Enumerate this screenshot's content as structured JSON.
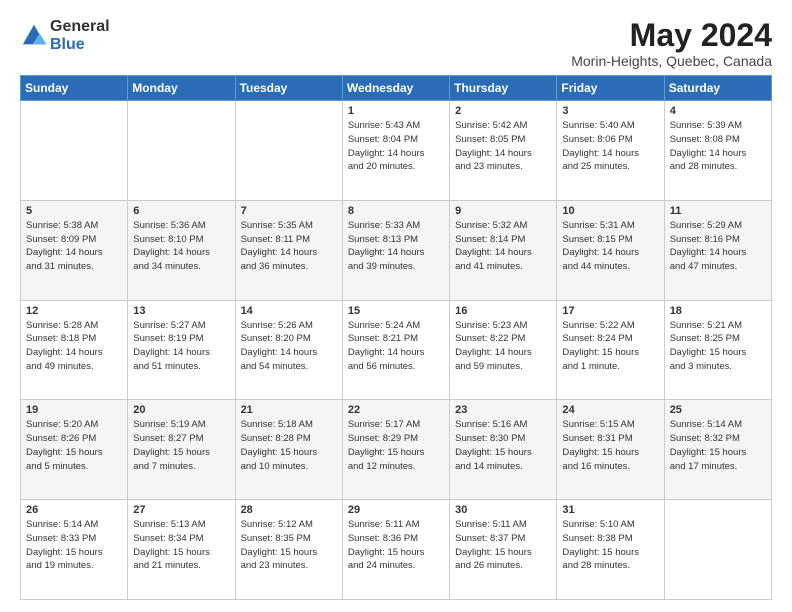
{
  "logo": {
    "general": "General",
    "blue": "Blue"
  },
  "title": "May 2024",
  "location": "Morin-Heights, Quebec, Canada",
  "days_of_week": [
    "Sunday",
    "Monday",
    "Tuesday",
    "Wednesday",
    "Thursday",
    "Friday",
    "Saturday"
  ],
  "weeks": [
    [
      {
        "day": "",
        "info": ""
      },
      {
        "day": "",
        "info": ""
      },
      {
        "day": "",
        "info": ""
      },
      {
        "day": "1",
        "info": "Sunrise: 5:43 AM\nSunset: 8:04 PM\nDaylight: 14 hours\nand 20 minutes."
      },
      {
        "day": "2",
        "info": "Sunrise: 5:42 AM\nSunset: 8:05 PM\nDaylight: 14 hours\nand 23 minutes."
      },
      {
        "day": "3",
        "info": "Sunrise: 5:40 AM\nSunset: 8:06 PM\nDaylight: 14 hours\nand 25 minutes."
      },
      {
        "day": "4",
        "info": "Sunrise: 5:39 AM\nSunset: 8:08 PM\nDaylight: 14 hours\nand 28 minutes."
      }
    ],
    [
      {
        "day": "5",
        "info": "Sunrise: 5:38 AM\nSunset: 8:09 PM\nDaylight: 14 hours\nand 31 minutes."
      },
      {
        "day": "6",
        "info": "Sunrise: 5:36 AM\nSunset: 8:10 PM\nDaylight: 14 hours\nand 34 minutes."
      },
      {
        "day": "7",
        "info": "Sunrise: 5:35 AM\nSunset: 8:11 PM\nDaylight: 14 hours\nand 36 minutes."
      },
      {
        "day": "8",
        "info": "Sunrise: 5:33 AM\nSunset: 8:13 PM\nDaylight: 14 hours\nand 39 minutes."
      },
      {
        "day": "9",
        "info": "Sunrise: 5:32 AM\nSunset: 8:14 PM\nDaylight: 14 hours\nand 41 minutes."
      },
      {
        "day": "10",
        "info": "Sunrise: 5:31 AM\nSunset: 8:15 PM\nDaylight: 14 hours\nand 44 minutes."
      },
      {
        "day": "11",
        "info": "Sunrise: 5:29 AM\nSunset: 8:16 PM\nDaylight: 14 hours\nand 47 minutes."
      }
    ],
    [
      {
        "day": "12",
        "info": "Sunrise: 5:28 AM\nSunset: 8:18 PM\nDaylight: 14 hours\nand 49 minutes."
      },
      {
        "day": "13",
        "info": "Sunrise: 5:27 AM\nSunset: 8:19 PM\nDaylight: 14 hours\nand 51 minutes."
      },
      {
        "day": "14",
        "info": "Sunrise: 5:26 AM\nSunset: 8:20 PM\nDaylight: 14 hours\nand 54 minutes."
      },
      {
        "day": "15",
        "info": "Sunrise: 5:24 AM\nSunset: 8:21 PM\nDaylight: 14 hours\nand 56 minutes."
      },
      {
        "day": "16",
        "info": "Sunrise: 5:23 AM\nSunset: 8:22 PM\nDaylight: 14 hours\nand 59 minutes."
      },
      {
        "day": "17",
        "info": "Sunrise: 5:22 AM\nSunset: 8:24 PM\nDaylight: 15 hours\nand 1 minute."
      },
      {
        "day": "18",
        "info": "Sunrise: 5:21 AM\nSunset: 8:25 PM\nDaylight: 15 hours\nand 3 minutes."
      }
    ],
    [
      {
        "day": "19",
        "info": "Sunrise: 5:20 AM\nSunset: 8:26 PM\nDaylight: 15 hours\nand 5 minutes."
      },
      {
        "day": "20",
        "info": "Sunrise: 5:19 AM\nSunset: 8:27 PM\nDaylight: 15 hours\nand 7 minutes."
      },
      {
        "day": "21",
        "info": "Sunrise: 5:18 AM\nSunset: 8:28 PM\nDaylight: 15 hours\nand 10 minutes."
      },
      {
        "day": "22",
        "info": "Sunrise: 5:17 AM\nSunset: 8:29 PM\nDaylight: 15 hours\nand 12 minutes."
      },
      {
        "day": "23",
        "info": "Sunrise: 5:16 AM\nSunset: 8:30 PM\nDaylight: 15 hours\nand 14 minutes."
      },
      {
        "day": "24",
        "info": "Sunrise: 5:15 AM\nSunset: 8:31 PM\nDaylight: 15 hours\nand 16 minutes."
      },
      {
        "day": "25",
        "info": "Sunrise: 5:14 AM\nSunset: 8:32 PM\nDaylight: 15 hours\nand 17 minutes."
      }
    ],
    [
      {
        "day": "26",
        "info": "Sunrise: 5:14 AM\nSunset: 8:33 PM\nDaylight: 15 hours\nand 19 minutes."
      },
      {
        "day": "27",
        "info": "Sunrise: 5:13 AM\nSunset: 8:34 PM\nDaylight: 15 hours\nand 21 minutes."
      },
      {
        "day": "28",
        "info": "Sunrise: 5:12 AM\nSunset: 8:35 PM\nDaylight: 15 hours\nand 23 minutes."
      },
      {
        "day": "29",
        "info": "Sunrise: 5:11 AM\nSunset: 8:36 PM\nDaylight: 15 hours\nand 24 minutes."
      },
      {
        "day": "30",
        "info": "Sunrise: 5:11 AM\nSunset: 8:37 PM\nDaylight: 15 hours\nand 26 minutes."
      },
      {
        "day": "31",
        "info": "Sunrise: 5:10 AM\nSunset: 8:38 PM\nDaylight: 15 hours\nand 28 minutes."
      },
      {
        "day": "",
        "info": ""
      }
    ]
  ]
}
